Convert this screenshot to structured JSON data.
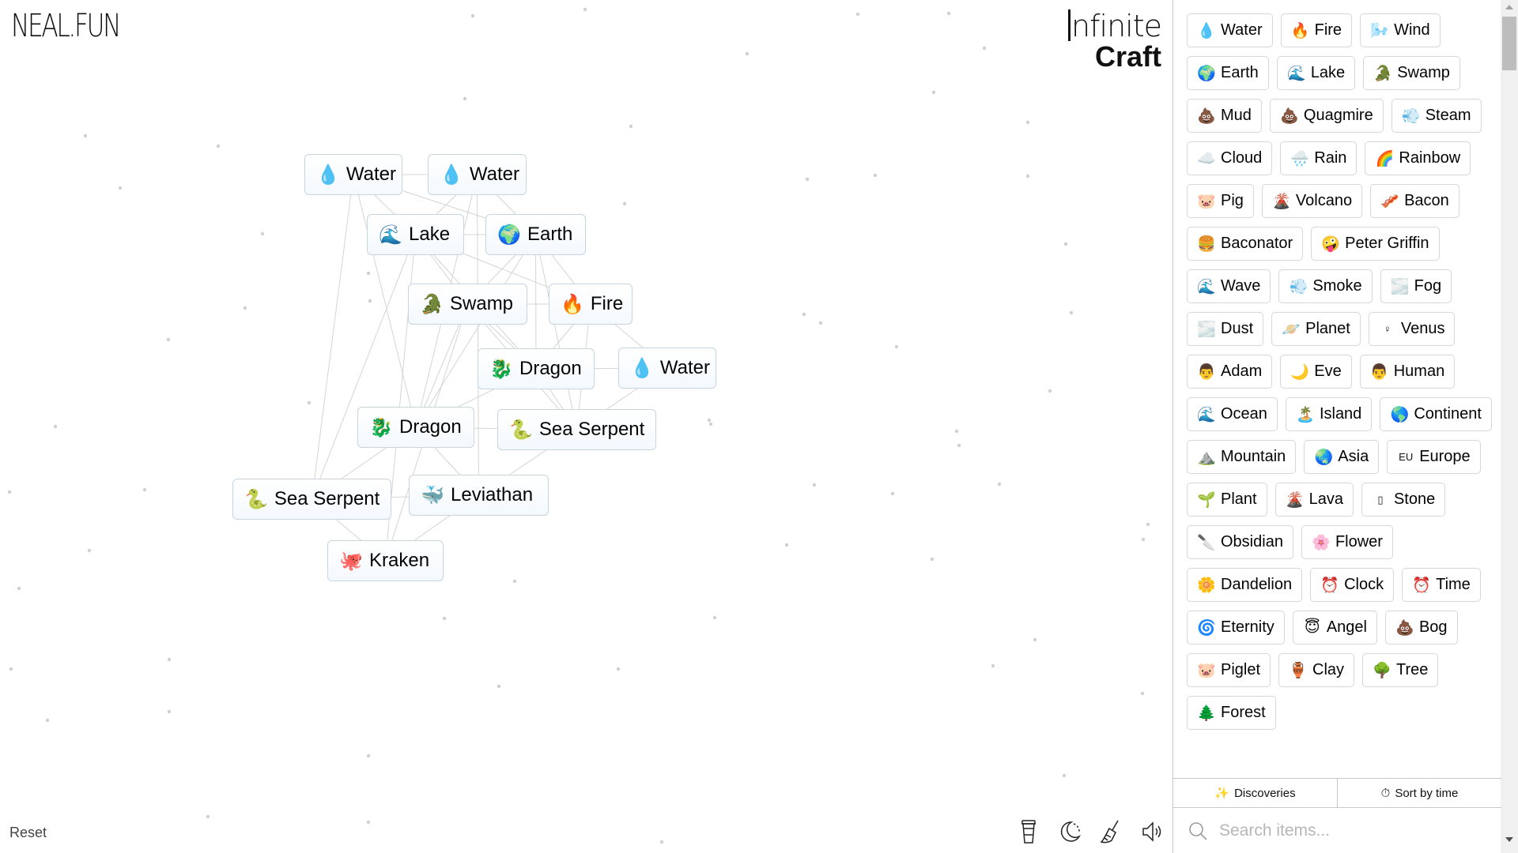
{
  "canvas": {
    "logo": "NEAL.FUN",
    "brand": {
      "line1": "nfinite",
      "line2": "Craft"
    },
    "reset_label": "Reset",
    "instances": [
      {
        "id": "water-1",
        "emoji": "💧",
        "label": "Water"
      },
      {
        "id": "water-2",
        "emoji": "💧",
        "label": "Water"
      },
      {
        "id": "lake",
        "emoji": "🌊",
        "label": "Lake"
      },
      {
        "id": "earth",
        "emoji": "🌍",
        "label": "Earth"
      },
      {
        "id": "swamp",
        "emoji": "🐊",
        "label": "Swamp"
      },
      {
        "id": "fire",
        "emoji": "🔥",
        "label": "Fire"
      },
      {
        "id": "dragon-1",
        "emoji": "🐉",
        "label": "Dragon"
      },
      {
        "id": "water-3",
        "emoji": "💧",
        "label": "Water"
      },
      {
        "id": "dragon-2",
        "emoji": "🐉",
        "label": "Dragon"
      },
      {
        "id": "sea-serpent-1",
        "emoji": "🐍",
        "label": "Sea Serpent"
      },
      {
        "id": "sea-serpent-2",
        "emoji": "🐍",
        "label": "Sea Serpent"
      },
      {
        "id": "leviathan",
        "emoji": "🐳",
        "label": "Leviathan"
      },
      {
        "id": "kraken",
        "emoji": "🐙",
        "label": "Kraken"
      }
    ],
    "tools": [
      {
        "name": "coffee-icon"
      },
      {
        "name": "dark-mode-icon"
      },
      {
        "name": "broom-icon"
      },
      {
        "name": "sound-icon"
      }
    ]
  },
  "sidebar": {
    "items": [
      {
        "emoji": "💧",
        "label": "Water"
      },
      {
        "emoji": "🔥",
        "label": "Fire"
      },
      {
        "emoji": "🌬️",
        "label": "Wind"
      },
      {
        "emoji": "🌍",
        "label": "Earth"
      },
      {
        "emoji": "🌊",
        "label": "Lake"
      },
      {
        "emoji": "🐊",
        "label": "Swamp"
      },
      {
        "emoji": "💩",
        "label": "Mud"
      },
      {
        "emoji": "💩",
        "label": "Quagmire"
      },
      {
        "emoji": "💨",
        "label": "Steam"
      },
      {
        "emoji": "☁️",
        "label": "Cloud"
      },
      {
        "emoji": "🌧️",
        "label": "Rain"
      },
      {
        "emoji": "🌈",
        "label": "Rainbow"
      },
      {
        "emoji": "🐷",
        "label": "Pig"
      },
      {
        "emoji": "🌋",
        "label": "Volcano"
      },
      {
        "emoji": "🥓",
        "label": "Bacon"
      },
      {
        "emoji": "🍔",
        "label": "Baconator"
      },
      {
        "emoji": "🤪",
        "label": "Peter Griffin"
      },
      {
        "emoji": "🌊",
        "label": "Wave"
      },
      {
        "emoji": "💨",
        "label": "Smoke"
      },
      {
        "emoji": "🌫️",
        "label": "Fog"
      },
      {
        "emoji": "🌫️",
        "label": "Dust"
      },
      {
        "emoji": "🪐",
        "label": "Planet"
      },
      {
        "emoji": "♀",
        "label": "Venus"
      },
      {
        "emoji": "👨",
        "label": "Adam"
      },
      {
        "emoji": "🌙",
        "label": "Eve"
      },
      {
        "emoji": "👨",
        "label": "Human"
      },
      {
        "emoji": "🌊",
        "label": "Ocean"
      },
      {
        "emoji": "🏝️",
        "label": "Island"
      },
      {
        "emoji": "🌎",
        "label": "Continent"
      },
      {
        "emoji": "⛰️",
        "label": "Mountain"
      },
      {
        "emoji": "🌏",
        "label": "Asia"
      },
      {
        "emoji": "EU",
        "label": "Europe"
      },
      {
        "emoji": "🌱",
        "label": "Plant"
      },
      {
        "emoji": "🌋",
        "label": "Lava"
      },
      {
        "emoji": "▯",
        "label": "Stone"
      },
      {
        "emoji": "🔪",
        "label": "Obsidian"
      },
      {
        "emoji": "🌸",
        "label": "Flower"
      },
      {
        "emoji": "🌼",
        "label": "Dandelion"
      },
      {
        "emoji": "⏰",
        "label": "Clock"
      },
      {
        "emoji": "⏰",
        "label": "Time"
      },
      {
        "emoji": "🌀",
        "label": "Eternity"
      },
      {
        "emoji": "😇",
        "label": "Angel"
      },
      {
        "emoji": "💩",
        "label": "Bog"
      },
      {
        "emoji": "🐷",
        "label": "Piglet"
      },
      {
        "emoji": "🏺",
        "label": "Clay"
      },
      {
        "emoji": "🌳",
        "label": "Tree"
      },
      {
        "emoji": "🌲",
        "label": "Forest"
      }
    ],
    "discoveries_label": "Discoveries",
    "sort_label": "Sort by time",
    "search_placeholder": "Search items..."
  }
}
